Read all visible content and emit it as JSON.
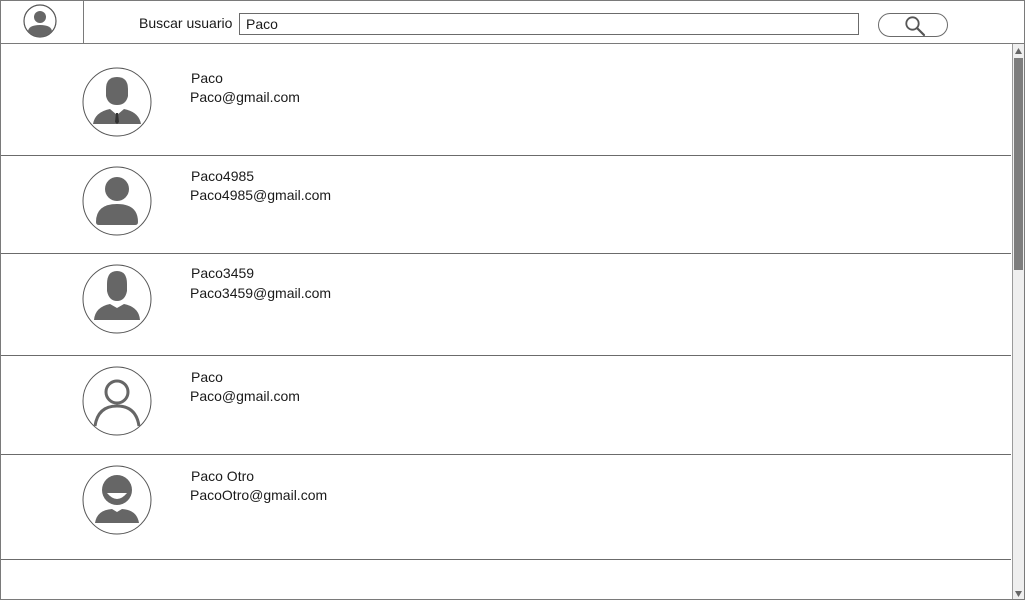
{
  "header": {
    "search_label": "Buscar usuario",
    "search_value": "Paco",
    "profile_icon": "user-avatar-icon",
    "search_icon": "search-icon"
  },
  "results": [
    {
      "name": "Paco",
      "email": "Paco@gmail.com",
      "avatar": "businessman-avatar"
    },
    {
      "name": "Paco4985",
      "email": "Paco4985@gmail.com",
      "avatar": "person-avatar"
    },
    {
      "name": "Paco3459",
      "email": "Paco3459@gmail.com",
      "avatar": "man-avatar"
    },
    {
      "name": "Paco",
      "email": "Paco@gmail.com",
      "avatar": "outline-person-avatar"
    },
    {
      "name": "Paco Otro",
      "email": "PacoOtro@gmail.com",
      "avatar": "smiling-person-avatar"
    }
  ],
  "colors": {
    "icon_fill": "#666666",
    "border": "#7a7a7a"
  }
}
